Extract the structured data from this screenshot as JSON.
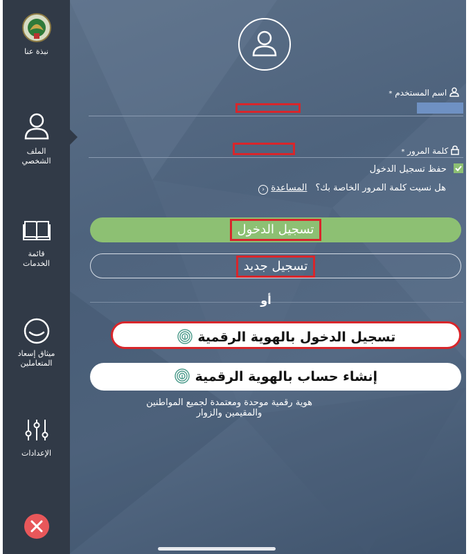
{
  "sidebar": {
    "items": [
      {
        "label": "نبذة عنا",
        "icon": "emblem-logo"
      },
      {
        "label": "الملف الشخصي",
        "icon": "person-icon"
      },
      {
        "label": "قائمة الخدمات",
        "icon": "book-icon"
      },
      {
        "label": "ميثاق إسعاد المتعاملين",
        "icon": "smile-icon"
      },
      {
        "label": "الإعدادات",
        "icon": "sliders-icon"
      }
    ],
    "close_icon": "close-icon"
  },
  "form": {
    "username_label": "اسم المستخدم",
    "password_label": "كلمة المرور",
    "required_mark": "*",
    "remember_label": "حفظ تسجيل الدخول",
    "forgot_text": "هل نسيت كلمة المرور الخاصة بك؟",
    "help_link": "المساعدة",
    "login_button": "تسجيل الدخول",
    "register_button": "تسجيل جديد",
    "or_text": "أو",
    "uaepass_login_button": "تسجيل الدخول بالهوية الرقمية",
    "uaepass_create_button": "إنشاء حساب بالهوية الرقمية",
    "uaepass_description": "هوية رقمية موحدة ومعتمدة لجميع المواطنين والمقيمين والزوار"
  },
  "colors": {
    "sidebar": "#313a47",
    "login_green": "#8dc073",
    "highlight_red": "#d8262b",
    "close_red": "#e8575a"
  }
}
